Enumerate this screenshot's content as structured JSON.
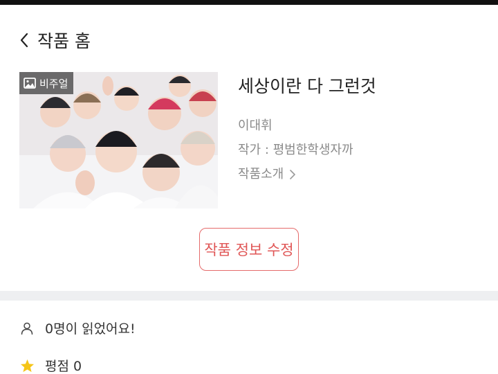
{
  "header": {
    "title": "작품 홈",
    "back_icon": "chevron-left-icon"
  },
  "cover": {
    "badge_label": "비주얼",
    "badge_icon": "image-icon"
  },
  "work": {
    "title": "세상이란 다 그런것",
    "subject": "이대휘",
    "author": "작가 : 평범한학생자까",
    "intro_label": "작품소개"
  },
  "actions": {
    "edit_label": "작품 정보 수정",
    "edit_color": "#e05555"
  },
  "stats": {
    "readers_label": "0명이 읽었어요!",
    "readers_icon": "person-icon",
    "rating_label": "평점 0",
    "rating_icon": "star-icon",
    "star_color": "#f5c518"
  }
}
